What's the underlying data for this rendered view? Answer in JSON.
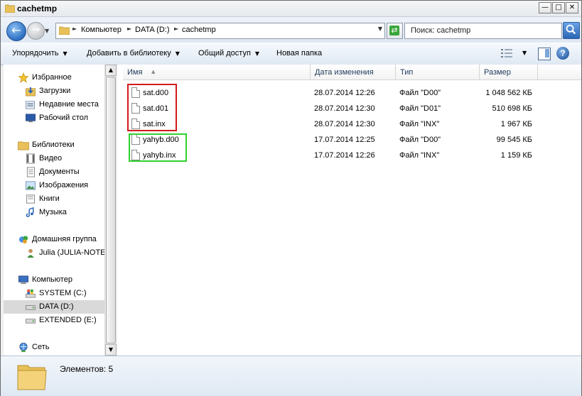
{
  "window": {
    "title": "cachetmp",
    "minimize": "—",
    "maximize": "□",
    "close": "✕"
  },
  "address": {
    "crumbs": [
      "Компьютер",
      "DATA (D:)",
      "cachetmp"
    ],
    "search_placeholder": "Поиск: cachetmp"
  },
  "toolbar": {
    "organize": "Упорядочить",
    "add_library": "Добавить в библиотеку",
    "share": "Общий доступ",
    "new_folder": "Новая папка"
  },
  "nav": {
    "favorites": {
      "label": "Избранное",
      "items": [
        "Загрузки",
        "Недавние места",
        "Рабочий стол"
      ]
    },
    "libraries": {
      "label": "Библиотеки",
      "items": [
        "Видео",
        "Документы",
        "Изображения",
        "Книги",
        "Музыка"
      ]
    },
    "homegroup": {
      "label": "Домашняя группа",
      "items": [
        "Julia (JULIA-NOTEE"
      ]
    },
    "computer": {
      "label": "Компьютер",
      "items": [
        "SYSTEM (C:)",
        "DATA (D:)",
        "EXTENDED (E:)"
      ]
    },
    "network": {
      "label": "Сеть"
    }
  },
  "columns": {
    "name": "Имя",
    "date": "Дата изменения",
    "type": "Тип",
    "size": "Размер"
  },
  "files": [
    {
      "name": "sat.d00",
      "date": "28.07.2014 12:26",
      "type": "Файл \"D00\"",
      "size": "1 048 562 КБ"
    },
    {
      "name": "sat.d01",
      "date": "28.07.2014 12:30",
      "type": "Файл \"D01\"",
      "size": "510 698 КБ"
    },
    {
      "name": "sat.inx",
      "date": "28.07.2014 12:30",
      "type": "Файл \"INX\"",
      "size": "1 967 КБ"
    },
    {
      "name": "yahyb.d00",
      "date": "17.07.2014 12:25",
      "type": "Файл \"D00\"",
      "size": "99 545 КБ"
    },
    {
      "name": "yahyb.inx",
      "date": "17.07.2014 12:26",
      "type": "Файл \"INX\"",
      "size": "1 159 КБ"
    }
  ],
  "status": {
    "count_text": "Элементов: 5"
  },
  "colors": {
    "highlight_red": "#d21a1a",
    "highlight_green": "#2fd12f",
    "selected_nav": "#d9d9d9"
  }
}
